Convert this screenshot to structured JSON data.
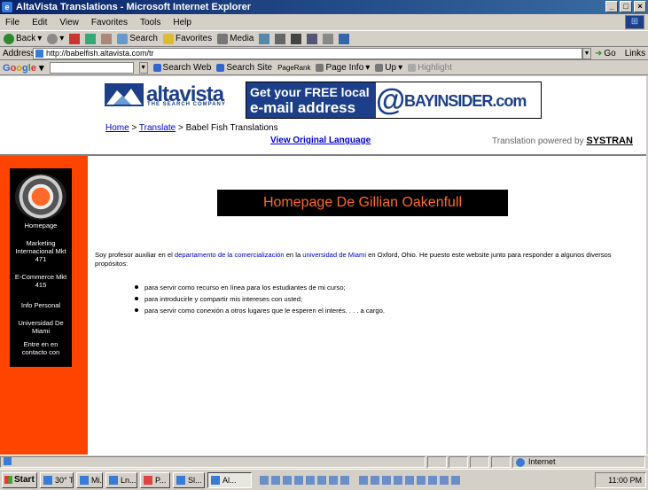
{
  "window": {
    "title": "AltaVista Translations - Microsoft Internet Explorer"
  },
  "menu": [
    "File",
    "Edit",
    "View",
    "Favorites",
    "Tools",
    "Help"
  ],
  "toolbar": {
    "back": "Back",
    "search": "Search",
    "favorites": "Favorites",
    "media": "Media"
  },
  "address": {
    "label": "Address",
    "url": "http://babelfish.altavista.com/tr",
    "go": "Go",
    "links": "Links"
  },
  "googlebar": {
    "search_web": "Search Web",
    "search_site": "Search Site",
    "pagerank": "PageRank",
    "page_info": "Page Info",
    "up": "Up",
    "highlight": "Highlight"
  },
  "header": {
    "logo_text": "altavista",
    "logo_sub": "THE SEARCH COMPANY",
    "banner_line1": "Get your FREE local",
    "banner_line2": "e-mail address",
    "banner_at": "@",
    "banner_brand": "BAYINSIDER.com"
  },
  "breadcrumb": {
    "home": "Home",
    "sep1": " > ",
    "translate": "Translate",
    "sep2": " > ",
    "current": "Babel Fish Translations"
  },
  "view_original": "View Original Language",
  "powered": {
    "prefix": "Translation powered by ",
    "brand": "SYSTRAN"
  },
  "sidebar": {
    "items": [
      "Homepage",
      "Marketing Internacional Mkt 471",
      "E-Commerce Mkt 415",
      "Info Personal",
      "Universidad De Miami",
      "Entre en en contacto con"
    ]
  },
  "main": {
    "heading": "Homepage De Gillian Oakenfull",
    "intro_a": "Soy profesor auxiliar en el ",
    "intro_link1": "departamento de la comercialización",
    "intro_b": " en la ",
    "intro_link2": "universidad de Miami",
    "intro_c": " en Oxford, Ohio. He puesto este website junto para responder a algunos diversos propósitos:",
    "bullets": [
      "para servir como recurso en línea para los estudiantes de mi curso;",
      "para introducirle y compartir mis intereses con usted;",
      "para servir como conexión a otros lugares que le esperen el interés. . . . a cargo."
    ]
  },
  "status": {
    "zone": "Internet"
  },
  "taskbar": {
    "start": "Start",
    "tasks": [
      "30° T...",
      "Mi...",
      "Ln...",
      "P...",
      "Sl...",
      "Al..."
    ],
    "clock": "11:00 PM"
  }
}
